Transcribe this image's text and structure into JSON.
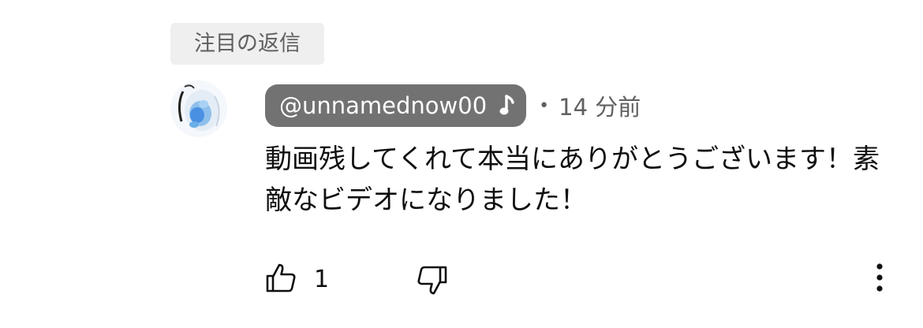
{
  "pinned_reply": {
    "label": "注目の返信"
  },
  "comment": {
    "author": "@unnamednow00",
    "author_badge_icon": "music-note-icon",
    "separator": "•",
    "timestamp": "14 分前",
    "text": "動画残してくれて本当にありがとうございます！素敵なビデオになりました！",
    "like_count": "1"
  },
  "icons": {
    "like": "thumbs-up-icon",
    "dislike": "thumbs-down-icon",
    "more": "more-vert-icon"
  },
  "colors": {
    "author_chip_bg": "#727272",
    "pinned_chip_bg": "#efefef",
    "secondary_text": "#606060"
  }
}
